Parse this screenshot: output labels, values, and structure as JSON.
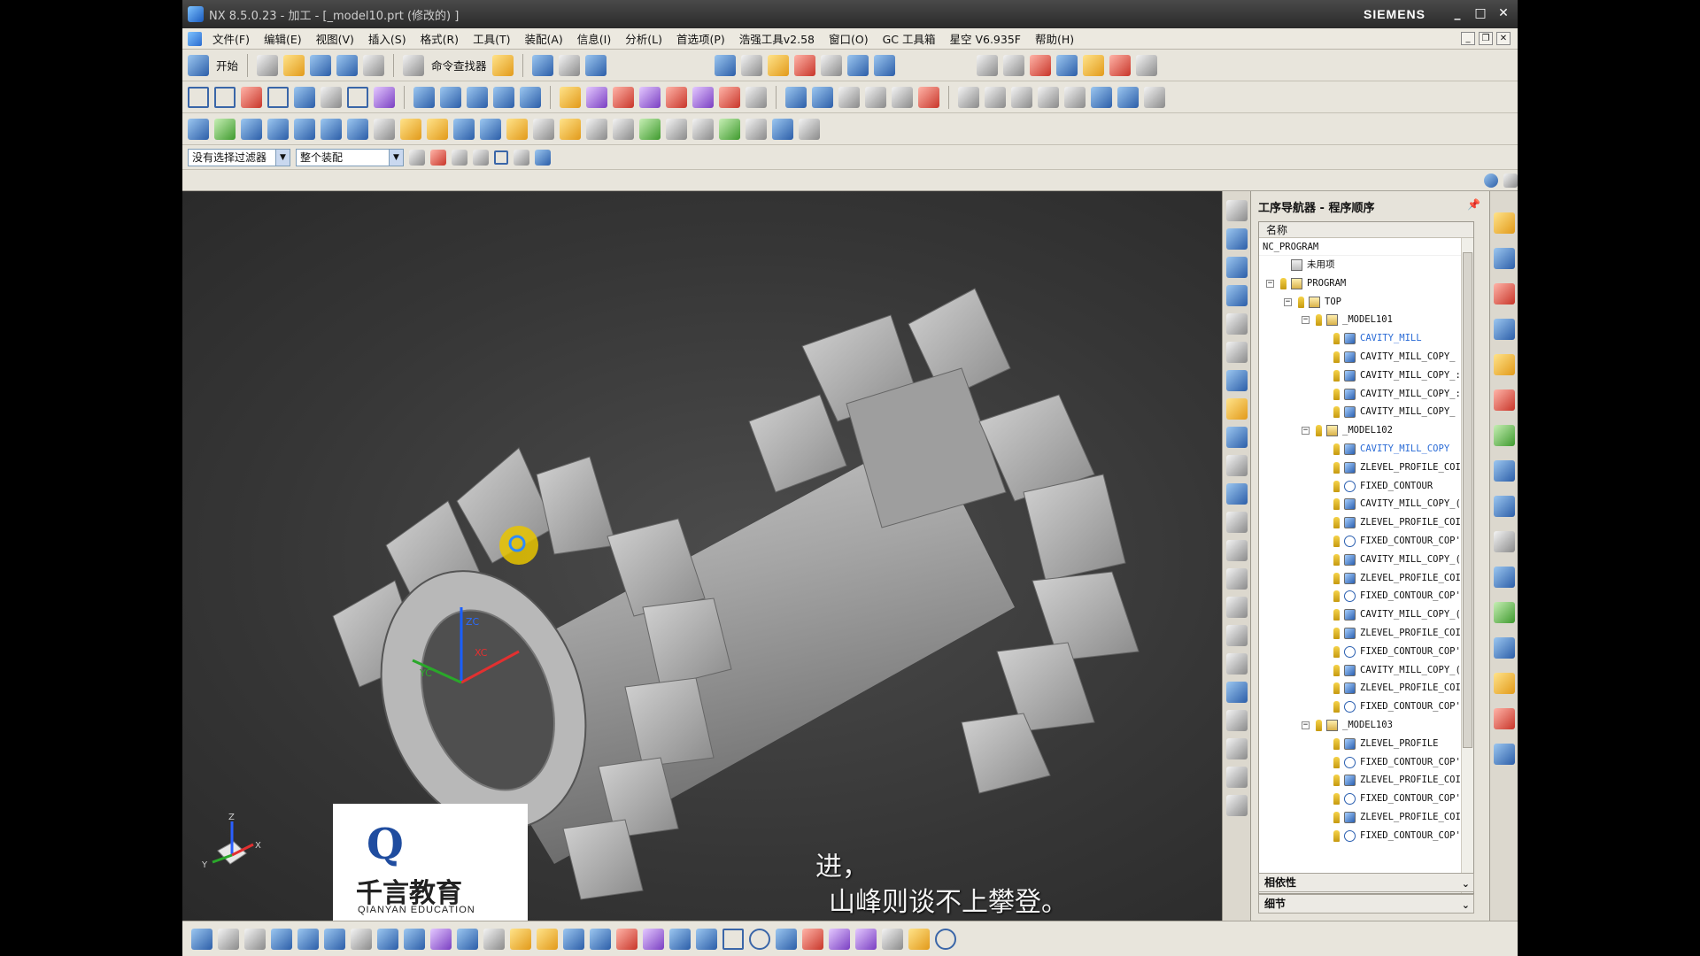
{
  "window": {
    "title": "NX 8.5.0.23 - 加工 - [_model10.prt  (修改的) ]",
    "brand": "SIEMENS",
    "controls": [
      "_",
      "□",
      "✕"
    ]
  },
  "menu": {
    "items": [
      "开始",
      "文件(F)",
      "编辑(E)",
      "视图(V)",
      "插入(S)",
      "格式(R)",
      "工具(T)",
      "装配(A)",
      "信息(I)",
      "分析(L)",
      "首选项(P)",
      "浩强工具v2.58",
      "窗口(O)",
      "GC 工具箱",
      "星空 V6.935F",
      "帮助(H)"
    ]
  },
  "toolbar": {
    "start_label": "开始",
    "command_finder_label": "命令查找器",
    "filter_value": "没有选择过滤器",
    "assembly_value": "整个装配"
  },
  "navigator": {
    "title": "工序导航器 - 程序顺序",
    "column_name": "名称",
    "root": "NC_PROGRAM",
    "rows": [
      {
        "label": "未用项",
        "level": 0,
        "type": "unused"
      },
      {
        "label": "PROGRAM",
        "level": 0,
        "type": "folder",
        "toggle": "⊟"
      },
      {
        "label": "TOP",
        "level": 1,
        "type": "folder",
        "toggle": "⊟"
      },
      {
        "label": "_MODEL101",
        "level": 2,
        "type": "folder",
        "toggle": "⊟"
      },
      {
        "label": "CAVITY_MILL",
        "level": 3,
        "type": "op",
        "selected": true
      },
      {
        "label": "CAVITY_MILL_COPY_",
        "level": 3,
        "type": "op"
      },
      {
        "label": "CAVITY_MILL_COPY_:",
        "level": 3,
        "type": "op"
      },
      {
        "label": "CAVITY_MILL_COPY_:",
        "level": 3,
        "type": "op"
      },
      {
        "label": "CAVITY_MILL_COPY_",
        "level": 3,
        "type": "op"
      },
      {
        "label": "_MODEL102",
        "level": 2,
        "type": "folder",
        "toggle": "⊟"
      },
      {
        "label": "CAVITY_MILL_COPY",
        "level": 3,
        "type": "op",
        "selected": true
      },
      {
        "label": "ZLEVEL_PROFILE_COI",
        "level": 3,
        "type": "op"
      },
      {
        "label": "FIXED_CONTOUR",
        "level": 3,
        "type": "fixed"
      },
      {
        "label": "CAVITY_MILL_COPY_(",
        "level": 3,
        "type": "op"
      },
      {
        "label": "ZLEVEL_PROFILE_COI",
        "level": 3,
        "type": "op"
      },
      {
        "label": "FIXED_CONTOUR_COP'",
        "level": 3,
        "type": "fixed"
      },
      {
        "label": "CAVITY_MILL_COPY_(",
        "level": 3,
        "type": "op"
      },
      {
        "label": "ZLEVEL_PROFILE_COI",
        "level": 3,
        "type": "op"
      },
      {
        "label": "FIXED_CONTOUR_COP'",
        "level": 3,
        "type": "fixed"
      },
      {
        "label": "CAVITY_MILL_COPY_(",
        "level": 3,
        "type": "op"
      },
      {
        "label": "ZLEVEL_PROFILE_COI",
        "level": 3,
        "type": "op"
      },
      {
        "label": "FIXED_CONTOUR_COP'",
        "level": 3,
        "type": "fixed"
      },
      {
        "label": "CAVITY_MILL_COPY_(",
        "level": 3,
        "type": "op"
      },
      {
        "label": "ZLEVEL_PROFILE_COI",
        "level": 3,
        "type": "op"
      },
      {
        "label": "FIXED_CONTOUR_COP'",
        "level": 3,
        "type": "fixed"
      },
      {
        "label": "_MODEL103",
        "level": 2,
        "type": "folder",
        "toggle": "⊟"
      },
      {
        "label": "ZLEVEL_PROFILE",
        "level": 3,
        "type": "op"
      },
      {
        "label": "FIXED_CONTOUR_COP'",
        "level": 3,
        "type": "fixed"
      },
      {
        "label": "ZLEVEL_PROFILE_COI",
        "level": 3,
        "type": "op"
      },
      {
        "label": "FIXED_CONTOUR_COP'",
        "level": 3,
        "type": "fixed"
      },
      {
        "label": "ZLEVEL_PROFILE_COI",
        "level": 3,
        "type": "op"
      },
      {
        "label": "FIXED_CONTOUR_COP'",
        "level": 3,
        "type": "fixed"
      }
    ],
    "dependencies_label": "相依性",
    "details_label": "细节"
  },
  "viewport": {
    "axis_labels": {
      "x": "X",
      "y": "Y",
      "z": "Z",
      "xc": "XC",
      "yc": "YC",
      "zc": "ZC"
    },
    "subtitle_line1": "进，",
    "subtitle_line2": "山峰则谈不上攀登。"
  },
  "watermark": {
    "cn": "千言教育",
    "en": "QIANYAN EDUCATION"
  },
  "colors": {
    "selected_text": "#2a6bd6",
    "viewport_bg": "#3a3a3a",
    "part_gray": "#a9a9a9",
    "watermark_blue": "#1f4c9f"
  }
}
